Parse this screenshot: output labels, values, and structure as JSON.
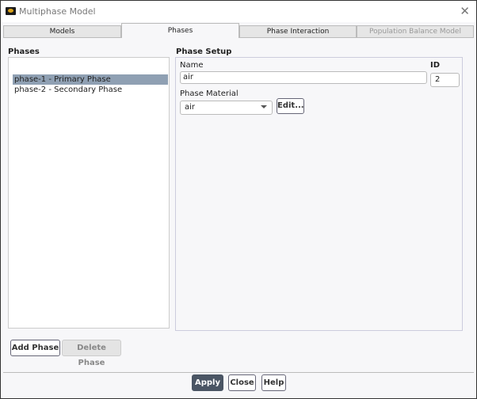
{
  "window": {
    "title": "Multiphase Model"
  },
  "tabs": [
    {
      "label": "Models"
    },
    {
      "label": "Phases"
    },
    {
      "label": "Phase Interaction"
    },
    {
      "label": "Population Balance Model"
    }
  ],
  "phases": {
    "heading": "Phases",
    "items": [
      {
        "label": "phase-1 - Primary Phase",
        "selected": true
      },
      {
        "label": "phase-2 - Secondary Phase",
        "selected": false
      }
    ],
    "add_label": "Add Phase",
    "delete_label": "Delete Phase"
  },
  "setup": {
    "heading": "Phase Setup",
    "name_label": "Name",
    "name_value": "air",
    "id_label": "ID",
    "id_value": "2",
    "material_label": "Phase Material",
    "material_value": "air",
    "edit_label": "Edit..."
  },
  "footer": {
    "apply": "Apply",
    "close": "Close",
    "help": "Help"
  }
}
